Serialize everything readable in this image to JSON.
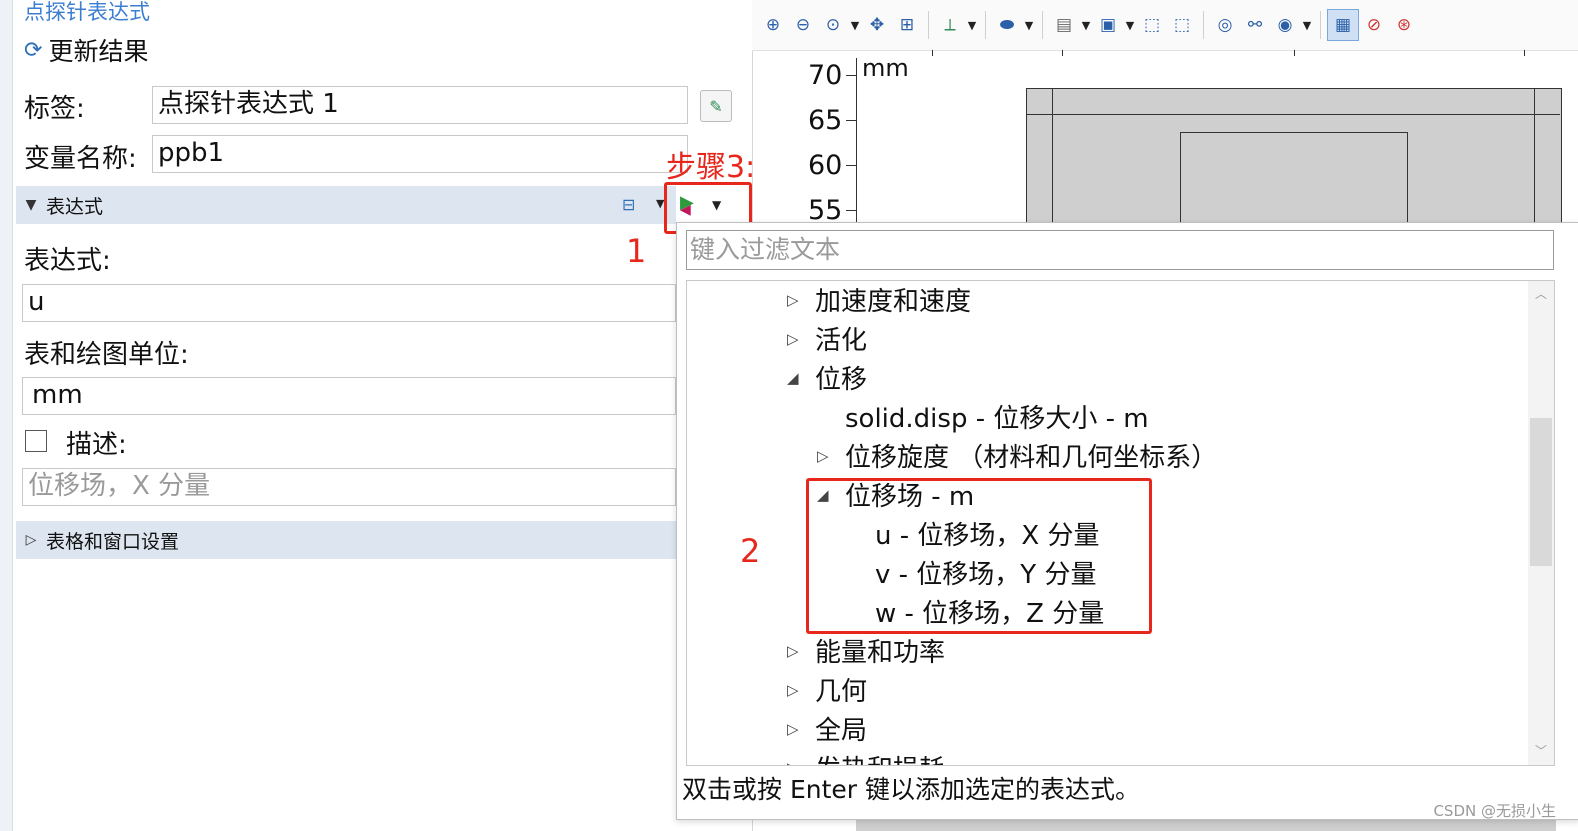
{
  "panel": {
    "title": "点探针表达式",
    "refresh_label": "更新结果",
    "label_caption": "标签:",
    "label_value": "点探针表达式 1",
    "varname_caption": "变量名称:",
    "varname_value": "ppb1",
    "section_expression": "表达式",
    "expression_caption": "表达式:",
    "expression_value": "u",
    "unit_caption": "表和绘图单位:",
    "unit_value": "mm",
    "description_caption": "描述:",
    "description_placeholder": "位移场，X 分量",
    "section_table": "表格和窗口设置"
  },
  "annotations": {
    "step3": "步骤3:",
    "one": "1",
    "two": "2"
  },
  "graphics": {
    "unit": "mm",
    "y_ticks": [
      "70",
      "65",
      "60",
      "55"
    ]
  },
  "popup": {
    "filter_placeholder": "键入过滤文本",
    "tree": [
      {
        "label": "加速度和速度",
        "level": 0,
        "state": "collapsed"
      },
      {
        "label": "活化",
        "level": 0,
        "state": "collapsed"
      },
      {
        "label": "位移",
        "level": 0,
        "state": "expanded"
      },
      {
        "label": "solid.disp - 位移大小 - m",
        "level": 1,
        "state": "leaf"
      },
      {
        "label": "位移旋度 （材料和几何坐标系）",
        "level": 1,
        "state": "collapsed"
      },
      {
        "label": "位移场 - m",
        "level": 1,
        "state": "expanded"
      },
      {
        "label": "u - 位移场，X 分量",
        "level": 2,
        "state": "leaf"
      },
      {
        "label": "v - 位移场，Y 分量",
        "level": 2,
        "state": "leaf"
      },
      {
        "label": "w - 位移场，Z 分量",
        "level": 2,
        "state": "leaf"
      },
      {
        "label": "能量和功率",
        "level": 0,
        "state": "collapsed"
      },
      {
        "label": "几何",
        "level": 0,
        "state": "collapsed"
      },
      {
        "label": "全局",
        "level": 0,
        "state": "collapsed"
      },
      {
        "label": "发热和损耗",
        "level": 0,
        "state": "collapsed"
      }
    ],
    "hint": "双击或按 Enter 键以添加选定的表达式。"
  },
  "watermark": "CSDN @无损小生",
  "colors": {
    "accent": "#3b7ed0",
    "annotation_red": "#e8271c",
    "section_bg": "#dde6f0"
  }
}
